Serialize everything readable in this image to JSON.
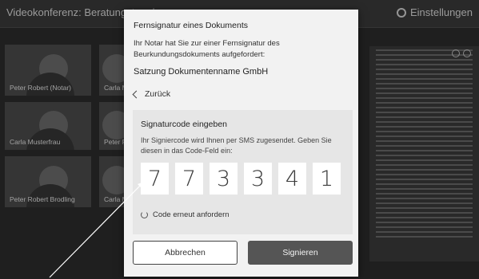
{
  "app": {
    "title": "Videokonferenz: Beratungstermin",
    "settings_label": "Einstellungen"
  },
  "tiles": [
    {
      "name": "Peter Robert (Notar)"
    },
    {
      "name": "Carla M"
    },
    {
      "name": "Carla Musterfrau"
    },
    {
      "name": "Peter Ro"
    },
    {
      "name": "Peter Robert Brodling"
    },
    {
      "name": "Carla M"
    }
  ],
  "modal": {
    "title": "Fernsignatur eines Dokuments",
    "intro": "Ihr Notar hat Sie zur einer Fernsignatur des Beurkundungsdokuments aufgefordert:",
    "document_name": "Satzung Dokumentenname GmbH",
    "back_label": "Zurück",
    "signature": {
      "title": "Signaturcode eingeben",
      "instructions": "Ihr Signiercode wird Ihnen per SMS zugesendet. Geben Sie diesen in das Code-Feld ein:",
      "digits": [
        "7",
        "7",
        "3",
        "3",
        "4",
        "1"
      ],
      "resend_label": "Code erneut anfordern"
    },
    "cancel_label": "Abbrechen",
    "sign_label": "Signieren"
  },
  "icons": {
    "settings": "gear-icon",
    "back": "chevron-left-icon",
    "resend": "refresh-icon"
  }
}
